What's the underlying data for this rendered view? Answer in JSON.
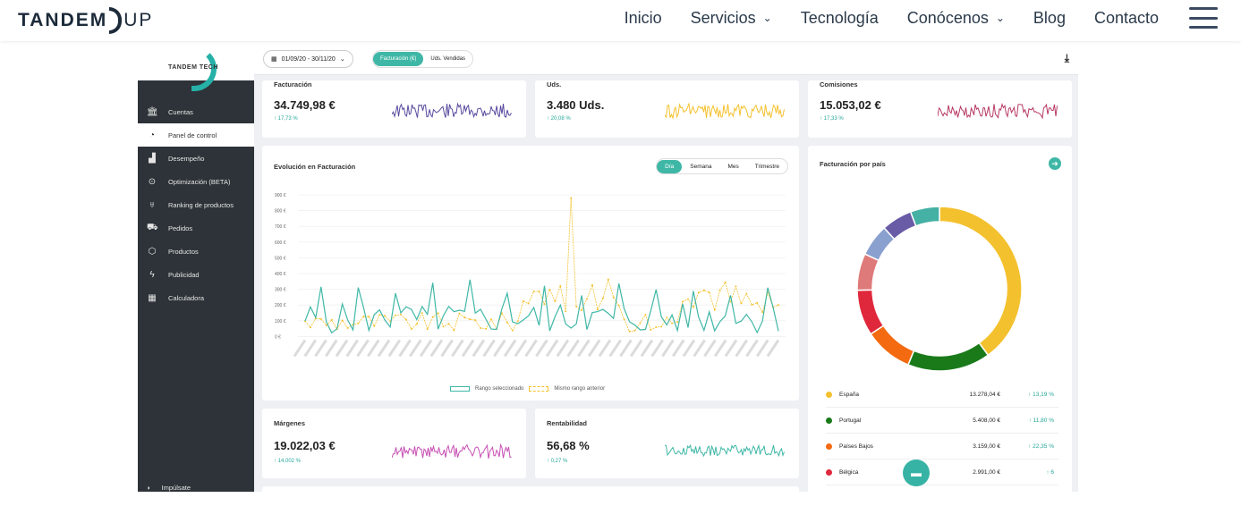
{
  "site": {
    "logo_bold": "TANDEM",
    "logo_light": "UP",
    "menu": [
      {
        "label": "Inicio",
        "chevron": false
      },
      {
        "label": "Servicios",
        "chevron": true
      },
      {
        "label": "Tecnología",
        "chevron": false
      },
      {
        "label": "Conócenos",
        "chevron": true
      },
      {
        "label": "Blog",
        "chevron": false
      },
      {
        "label": "Contacto",
        "chevron": false
      }
    ]
  },
  "app": {
    "logo_text": "TANDEM TECH",
    "sidebar": [
      {
        "label": "Cuentas",
        "icon": "bank-icon",
        "glyph": "🏛"
      },
      {
        "label": "Panel de control",
        "icon": "gauge-icon",
        "glyph": "◔",
        "active": true
      },
      {
        "label": "Desempeño",
        "icon": "bars-icon",
        "glyph": "▟"
      },
      {
        "label": "Optimización (BETA)",
        "icon": "magnifier-icon",
        "glyph": "⊙"
      },
      {
        "label": "Ranking de productos",
        "icon": "trophy-icon",
        "glyph": "♅"
      },
      {
        "label": "Pedidos",
        "icon": "truck-icon",
        "glyph": "⛟"
      },
      {
        "label": "Productos",
        "icon": "box-icon",
        "glyph": "⬡"
      },
      {
        "label": "Publicidad",
        "icon": "bolt-icon",
        "glyph": "ϟ"
      },
      {
        "label": "Calculadora",
        "icon": "calculator-icon",
        "glyph": "▦"
      }
    ],
    "sidebar_footer": "Impúlsate",
    "toolbar": {
      "date_range": "01/09/20 - 30/11/20",
      "toggle_on": "Facturación (€)",
      "toggle_off": "Uds. Vendidas",
      "download_icon": "download-icon"
    },
    "kpis": [
      {
        "title": "Facturación",
        "value": "34.749,98 €",
        "change": "↑ 17,73 %",
        "color": "#5a4a9e"
      },
      {
        "title": "Uds.",
        "value": "3.480 Uds.",
        "change": "↑ 20,08 %",
        "color": "#f4c12e"
      },
      {
        "title": "Comisiones",
        "value": "15.053,02 €",
        "change": "↑ 17,33 %",
        "color": "#b73a63"
      },
      {
        "title": "Márgenes",
        "value": "19.022,03 €",
        "change": "↑ 14,002 %",
        "color": "#c74fb3"
      },
      {
        "title": "Rentabilidad",
        "value": "56,68 %",
        "change": "↑ 0,27 %",
        "color": "#3fb7a6"
      }
    ],
    "evolution": {
      "title": "Evolución en Facturación",
      "periods": [
        "Día",
        "Semana",
        "Mes",
        "Trimestre"
      ],
      "active_period": "Día",
      "y_ticks": [
        "900 €",
        "800 €",
        "700 €",
        "600 €",
        "500 €",
        "400 €",
        "300 €",
        "200 €",
        "100 €",
        "0 €"
      ],
      "legend_selected": "Rango seleccionado",
      "legend_previous": "Mismo rango anterior",
      "colors": {
        "selected": "#3fb7a6",
        "previous": "#f4c12e"
      }
    },
    "countries_card": {
      "title": "Facturación por país",
      "rows": [
        {
          "name": "España",
          "value": "13.278,04 €",
          "change": "↑ 13,19 %",
          "color": "#f4c12e"
        },
        {
          "name": "Portugal",
          "value": "5.408,00 €",
          "change": "↑ 11,80 %",
          "color": "#1a7a1a"
        },
        {
          "name": "Países Bajos",
          "value": "3.159,00 €",
          "change": "↑ 22,35 %",
          "color": "#f36a10"
        },
        {
          "name": "Bélgica",
          "value": "2.991,00 €",
          "change": "↑ 6",
          "color": "#e0283c"
        }
      ],
      "extra_slice_colors": [
        "#df7a7a",
        "#8aa0cf",
        "#6a5ba6",
        "#45b0a4"
      ]
    }
  }
}
